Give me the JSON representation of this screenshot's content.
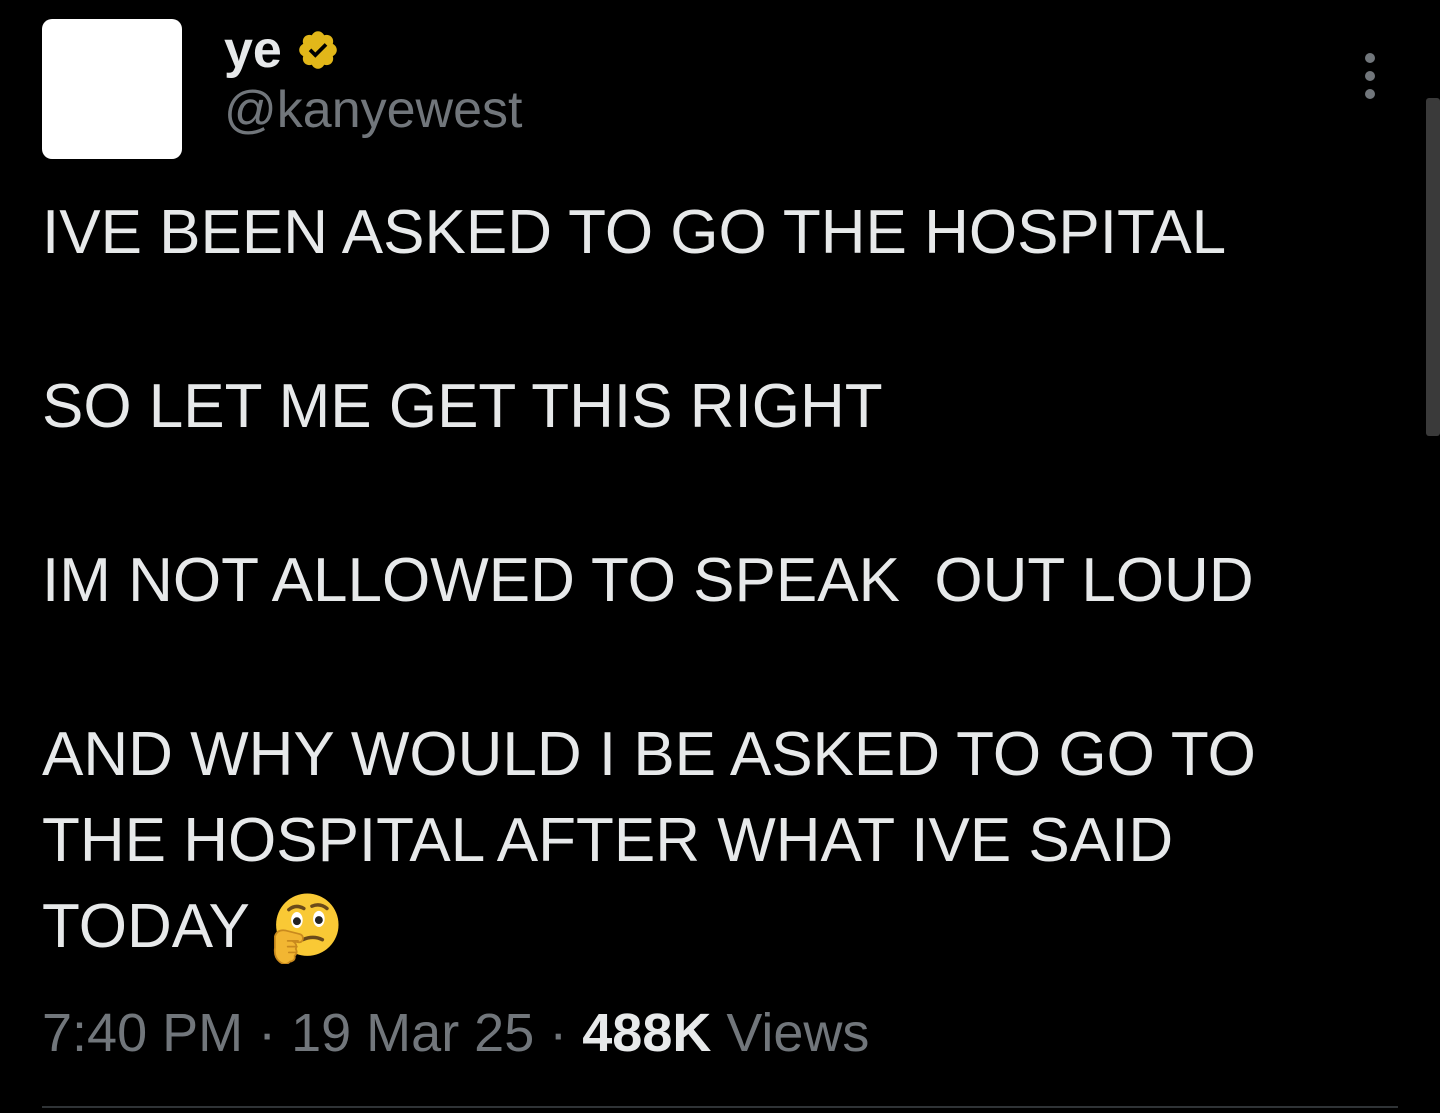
{
  "author": {
    "display_name": "ye",
    "handle": "@kanyewest",
    "verified_icon": "verified-badge-icon",
    "verified_color": "#e2b719"
  },
  "menu": {
    "icon": "more-vertical-icon"
  },
  "tweet": {
    "lines": [
      "IVE BEEN ASKED TO GO THE HOSPITAL",
      "SO LET ME GET THIS RIGHT",
      "IM NOT ALLOWED TO SPEAK  OUT LOUD",
      "AND WHY WOULD I BE ASKED TO GO TO",
      "THE HOSPITAL AFTER WHAT IVE SAID",
      "TODAY"
    ],
    "emoji": "thinking-face-emoji"
  },
  "meta": {
    "time": "7:40 PM",
    "separator": " · ",
    "date": "19 Mar 25",
    "views_count": "488K",
    "views_label": " Views"
  },
  "colors": {
    "background": "#000000",
    "text": "#e7e9ea",
    "muted": "#71767b"
  }
}
